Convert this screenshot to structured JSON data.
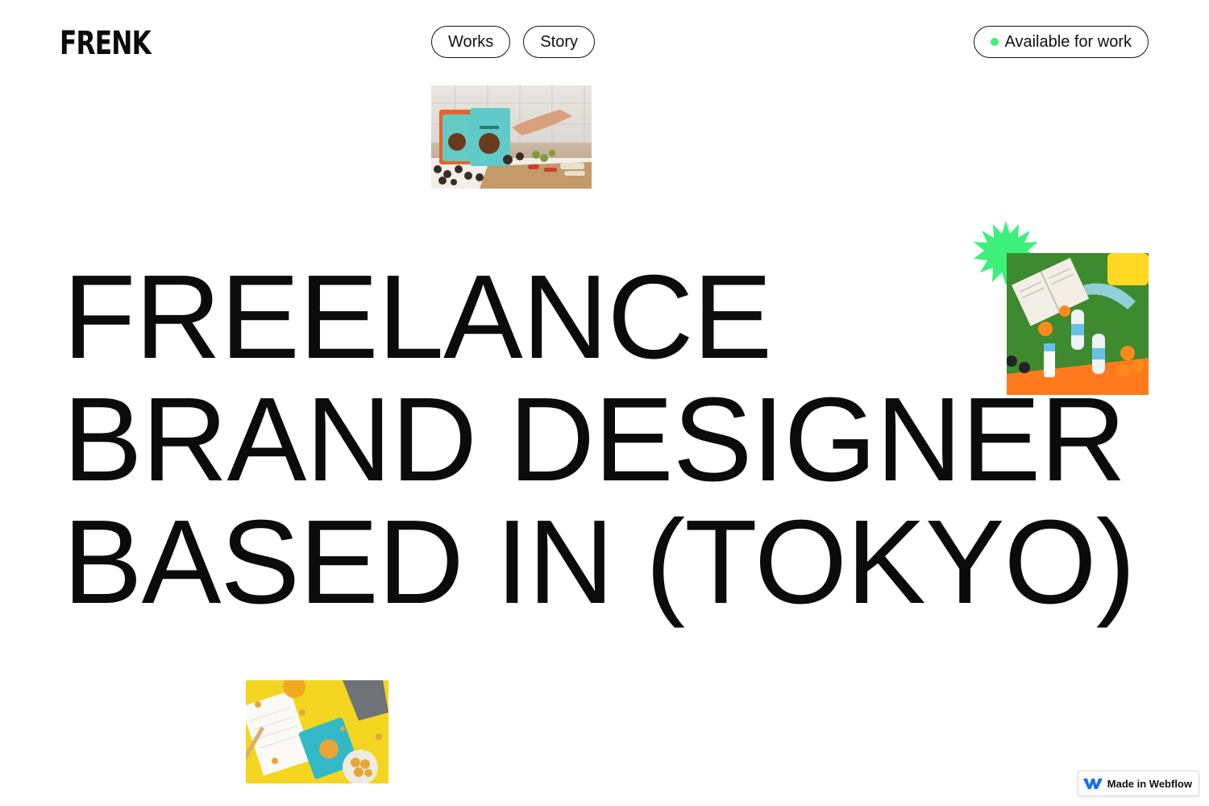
{
  "header": {
    "logo": "FRENK",
    "nav": [
      "Works",
      "Story"
    ],
    "status_label": "Available for work"
  },
  "hero": {
    "lines": [
      "FREELANCE",
      "BRAND DESIGNER",
      "BASED IN (TOKYO)"
    ]
  },
  "badge": {
    "label": "Made in Webflow"
  },
  "colors": {
    "status_dot": "#3df07a",
    "starburst": "#3df07a",
    "text": "#0b0b0b",
    "background": "#ffffff"
  },
  "icons": {
    "status": "green-dot-icon",
    "badge": "webflow-logo-icon",
    "decoration": "starburst-icon"
  }
}
